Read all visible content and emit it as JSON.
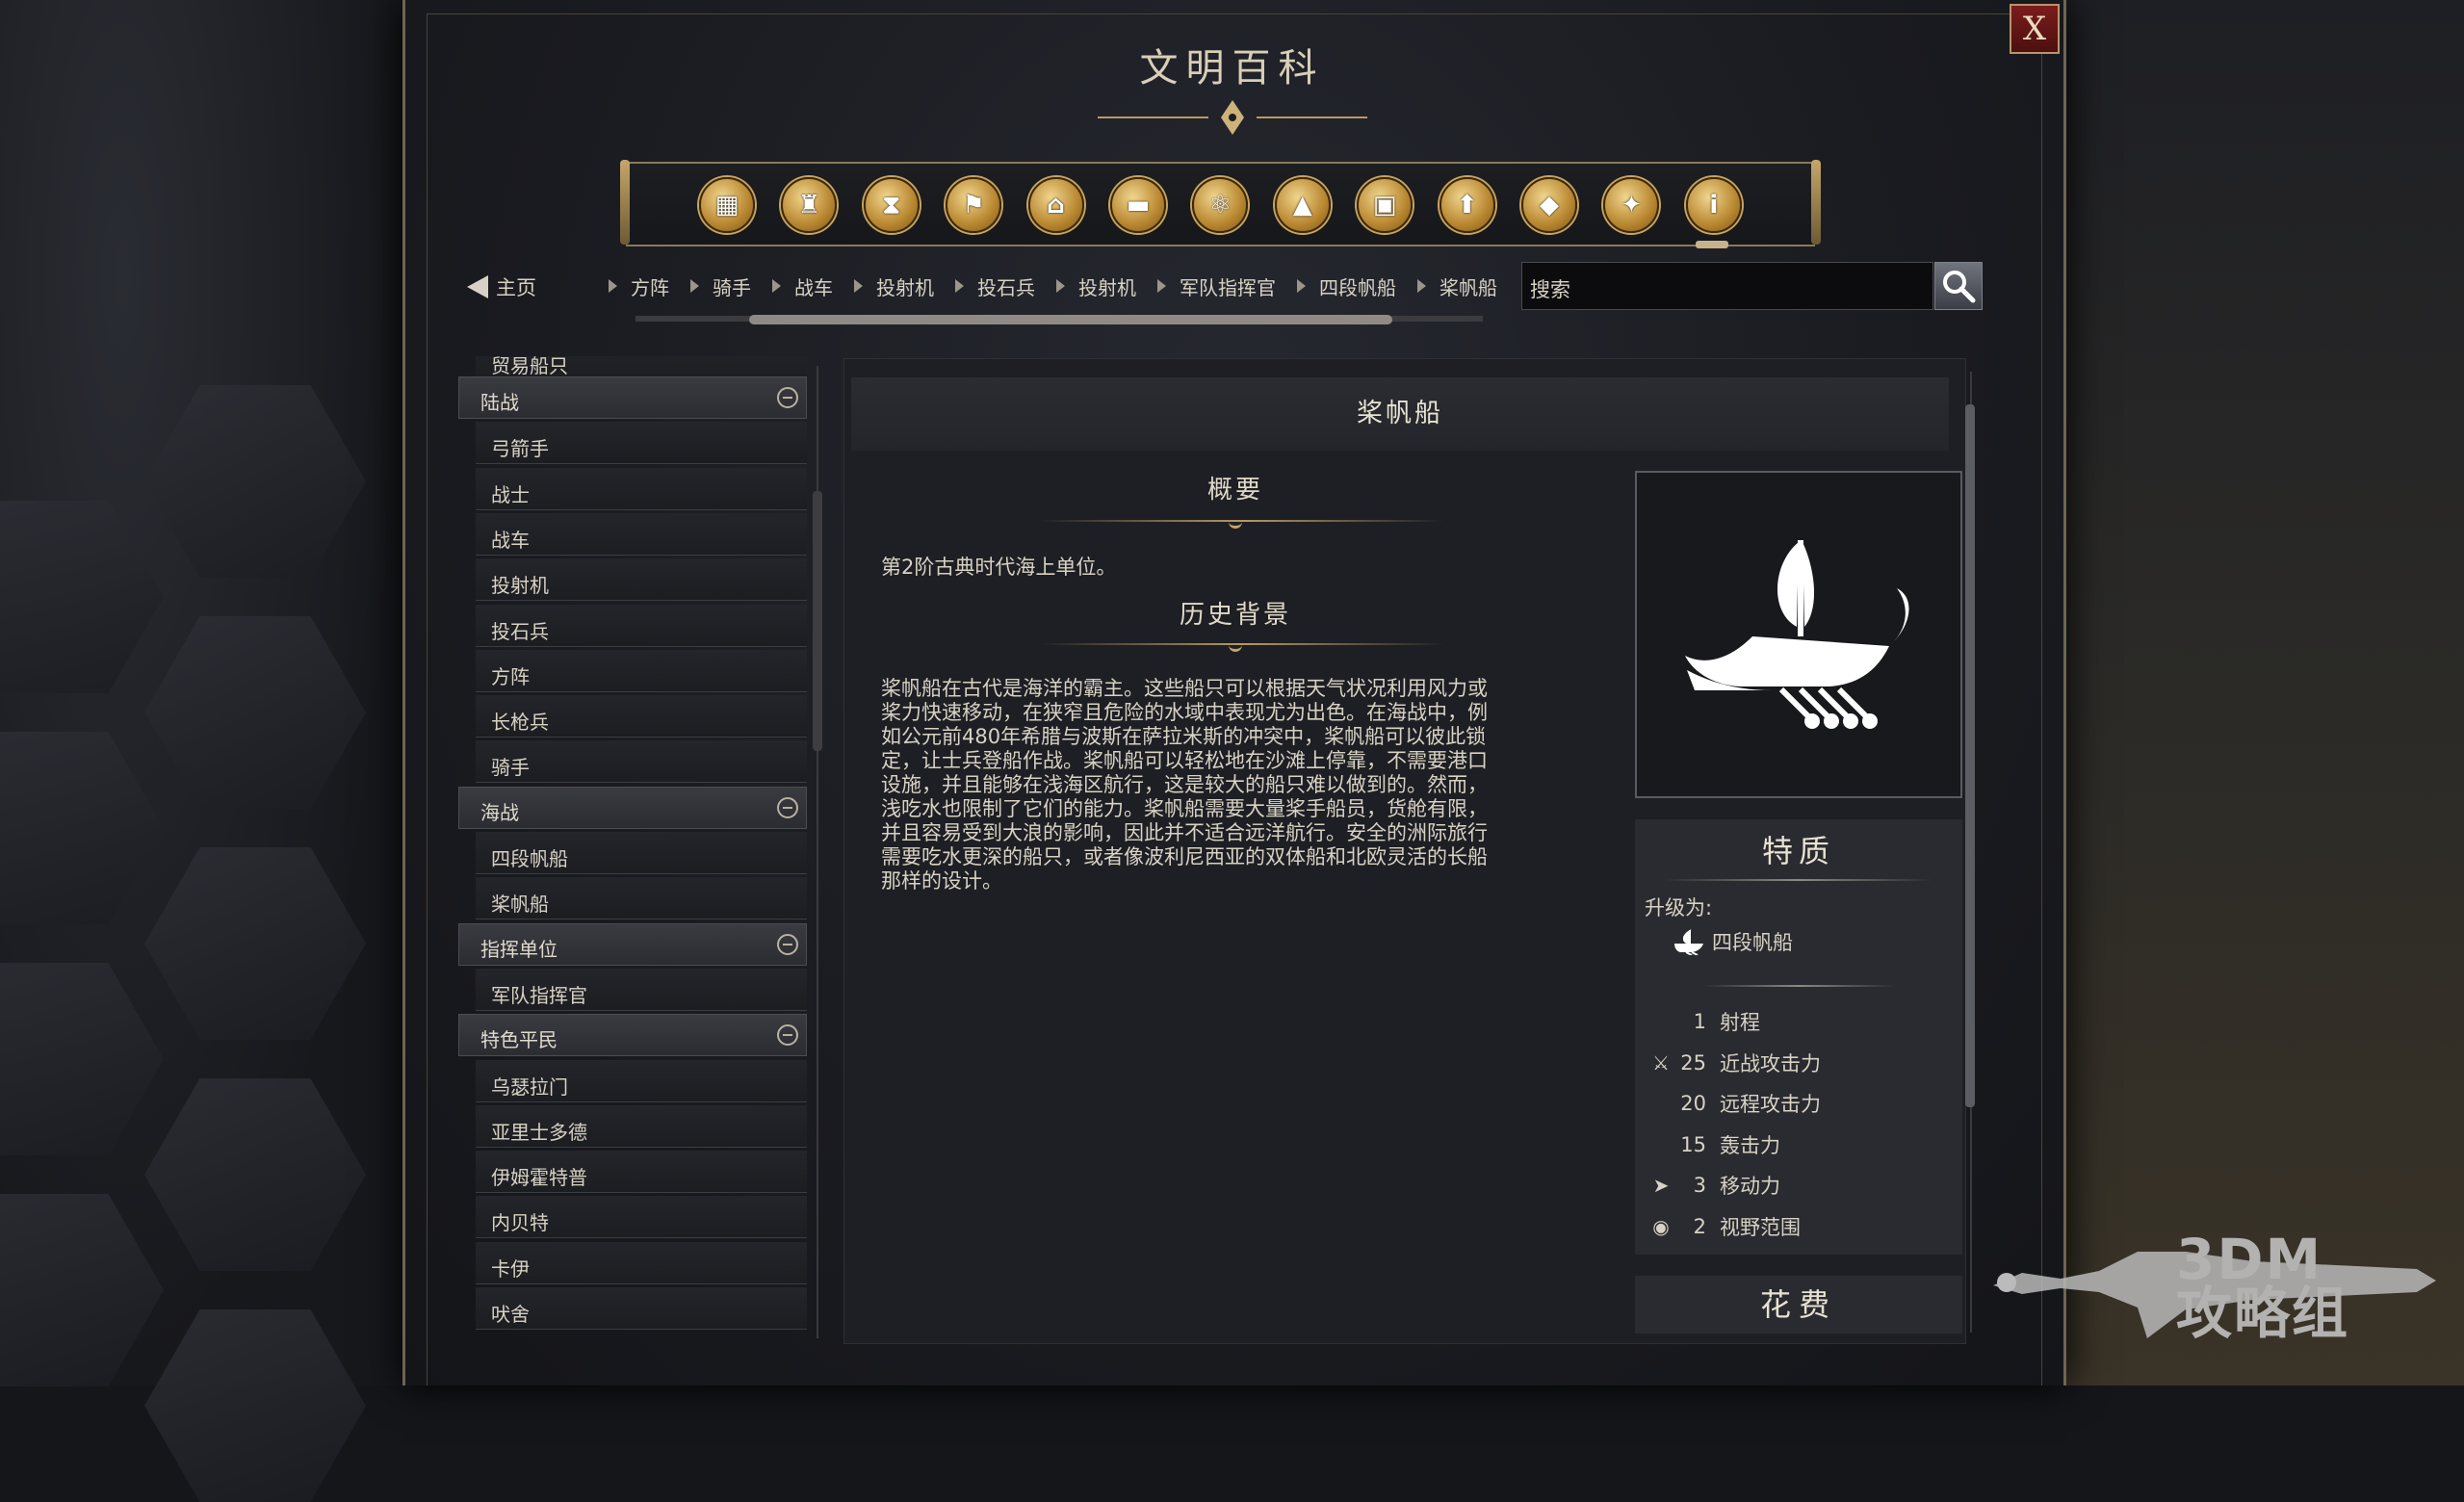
{
  "dialog": {
    "title": "文明百科",
    "close_label": "X"
  },
  "category_icons": [
    {
      "name": "units-icon",
      "glyph": "▦"
    },
    {
      "name": "buildings-icon",
      "glyph": "♜"
    },
    {
      "name": "ages-icon",
      "glyph": "⧗"
    },
    {
      "name": "civilizations-icon",
      "glyph": "⚑"
    },
    {
      "name": "wonders-icon",
      "glyph": "⌂"
    },
    {
      "name": "governments-icon",
      "glyph": "▬"
    },
    {
      "name": "technologies-icon",
      "glyph": "⚛"
    },
    {
      "name": "terrain-icon",
      "glyph": "▲"
    },
    {
      "name": "improvements-icon",
      "glyph": "▣"
    },
    {
      "name": "upgrades-icon",
      "glyph": "⬆"
    },
    {
      "name": "resources-icon",
      "glyph": "◆"
    },
    {
      "name": "leaders-icon",
      "glyph": "✦"
    },
    {
      "name": "info-icon",
      "glyph": "i"
    }
  ],
  "nav": {
    "home_label": "主页",
    "breadcrumbs": [
      "方阵",
      "骑手",
      "战车",
      "投射机",
      "投石兵",
      "投射机",
      "军队指挥官",
      "四段帆船",
      "桨帆船"
    ],
    "search_placeholder": "搜索"
  },
  "sidebar": {
    "partial_top": "贸易船只",
    "groups": [
      {
        "label": "陆战",
        "items": [
          "弓箭手",
          "战士",
          "战车",
          "投射机",
          "投石兵",
          "方阵",
          "长枪兵",
          "骑手"
        ]
      },
      {
        "label": "海战",
        "items": [
          "四段帆船",
          "桨帆船"
        ]
      },
      {
        "label": "指挥单位",
        "items": [
          "军队指挥官"
        ]
      },
      {
        "label": "特色平民",
        "items": [
          "乌瑟拉门",
          "亚里士多德",
          "伊姆霍特普",
          "内贝特",
          "卡伊",
          "吠舍"
        ]
      }
    ]
  },
  "article": {
    "title": "桨帆船",
    "overview_heading": "概要",
    "overview_text": "第2阶古典时代海上单位。",
    "history_heading": "历史背景",
    "history_lines": [
      "桨帆船在古代是海洋的霸主。这些船只可以根据天气状况利用风力或",
      "桨力快速移动，在狭窄且危险的水域中表现尤为出色。在海战中，例",
      "如公元前480年希腊与波斯在萨拉米斯的冲突中，桨帆船可以彼此锁",
      "定，让士兵登船作战。桨帆船可以轻松地在沙滩上停靠，不需要港口",
      "设施，并且能够在浅海区航行，这是较大的船只难以做到的。然而，",
      "浅吃水也限制了它们的能力。桨帆船需要大量桨手船员，货舱有限，",
      "并且容易受到大浪的影响，因此并不适合远洋航行。安全的洲际旅行",
      "需要吃水更深的船只，或者像波利尼西亚的双体船和北欧灵活的长船",
      "那样的设计。"
    ]
  },
  "traits": {
    "title": "特质",
    "upgrade_label": "升级为:",
    "upgrade_target": "四段帆船",
    "stats": [
      {
        "icon": "",
        "value": "1",
        "label": "射程"
      },
      {
        "icon": "sword-icon",
        "value": "25",
        "label": "近战攻击力"
      },
      {
        "icon": "",
        "value": "20",
        "label": "远程攻击力"
      },
      {
        "icon": "",
        "value": "15",
        "label": "轰击力"
      },
      {
        "icon": "movement-icon",
        "value": "3",
        "label": "移动力"
      },
      {
        "icon": "eye-icon",
        "value": "2",
        "label": "视野范围"
      }
    ],
    "cost_title": "花费"
  },
  "watermark": {
    "line1": "3DM",
    "line2": "攻略组"
  },
  "colors": {
    "gold": "#c9a45b",
    "close_red": "#7b1c1c",
    "panel_bg": "#1e1f24"
  }
}
